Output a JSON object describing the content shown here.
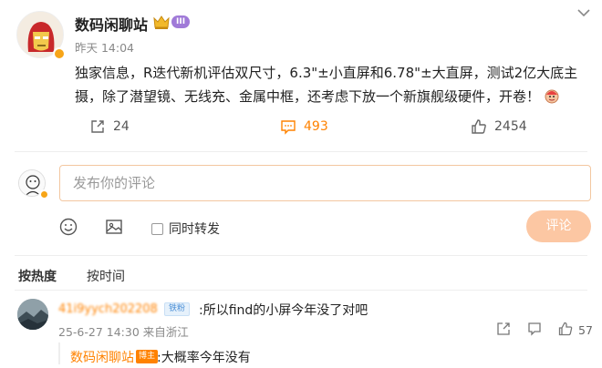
{
  "post": {
    "author": "数码闲聊站",
    "vip_level": "III",
    "time": "昨天 14:04",
    "content": "独家信息，R迭代新机评估双尺寸，6.3\"±小直屏和6.78\"±大直屏，测试2亿大底主摄，除了潜望镜、无线充、金属中框，还考虑下放一个新旗舰级硬件，开卷！"
  },
  "actions": {
    "reposts": "24",
    "comments": "493",
    "likes": "2454"
  },
  "comment_box": {
    "placeholder": "发布你的评论",
    "repost_label": "同时转发",
    "submit_label": "评论"
  },
  "sort": {
    "hot": "按热度",
    "time": "按时间"
  },
  "comments": [
    {
      "user": "41i9yych202208",
      "fans_badge": "铁粉",
      "text": ":所以find的小屏今年没了对吧",
      "meta": "25-6-27 14:30 来自浙江",
      "likes": "57",
      "reply": {
        "user": "数码闲聊站",
        "badge": "博主",
        "text": ":大概率今年没有"
      }
    }
  ],
  "colors": {
    "accent": "#ff8200",
    "submit_disabled": "#fcc7a3",
    "vip_purple": "#a07ad8"
  }
}
